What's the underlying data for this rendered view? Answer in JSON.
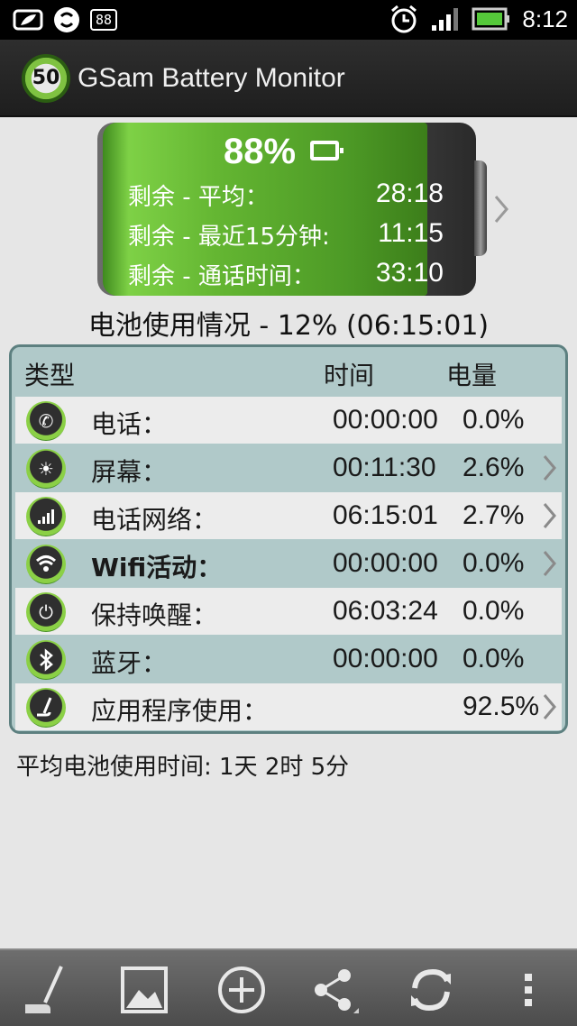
{
  "status_bar": {
    "badge": "88",
    "time": "8:12",
    "icons": [
      "leaf-icon",
      "sync-icon",
      "alarm-icon",
      "signal-icon",
      "battery-icon"
    ]
  },
  "app": {
    "title": "GSam Battery Monitor",
    "logo_number": "50"
  },
  "battery": {
    "percent_text": "88%",
    "level": 0.88,
    "remaining": [
      {
        "label": "剩余 - 平均：",
        "value": "28:18"
      },
      {
        "label": "剩余 - 最近15分钟:",
        "value": "11:15"
      },
      {
        "label": "剩余 - 通话时间：",
        "value": "33:10"
      }
    ]
  },
  "usage_title": "电池使用情况 - 12% (06:15:01)",
  "table": {
    "headers": {
      "type": "类型",
      "time": "时间",
      "power": "电量"
    },
    "rows": [
      {
        "icon": "phone-icon",
        "name": "电话：",
        "time": "00:00:00",
        "pct": "0.0%",
        "chevron": false
      },
      {
        "icon": "screen-brightness-icon",
        "name": "屏幕：",
        "time": "00:11:30",
        "pct": "2.6%",
        "chevron": true
      },
      {
        "icon": "cell-signal-icon",
        "name": "电话网络：",
        "time": "06:15:01",
        "pct": "2.7%",
        "chevron": true
      },
      {
        "icon": "wifi-icon",
        "name": "Wifi活动：",
        "time": "00:00:00",
        "pct": "0.0%",
        "chevron": true
      },
      {
        "icon": "power-icon",
        "name": "保持唤醒：",
        "time": "06:03:24",
        "pct": "0.0%",
        "chevron": false
      },
      {
        "icon": "bluetooth-icon",
        "name": "蓝牙：",
        "time": "00:00:00",
        "pct": "0.0%",
        "chevron": false
      },
      {
        "icon": "app-usage-icon",
        "name": "应用程序使用：",
        "time": "",
        "pct": "92.5%",
        "chevron": true
      }
    ]
  },
  "avg_usage": "平均电池使用时间: 1天 2时 5分",
  "toolbar": {
    "buttons": [
      "app-usage-tool-icon",
      "image-icon",
      "add-icon",
      "share-icon",
      "refresh-icon",
      "overflow-menu-icon"
    ]
  },
  "colors": {
    "panel_bg": "#b0c9c9",
    "panel_border": "#5d8080",
    "battery_green": "#64b632",
    "row_light": "#ececec"
  }
}
